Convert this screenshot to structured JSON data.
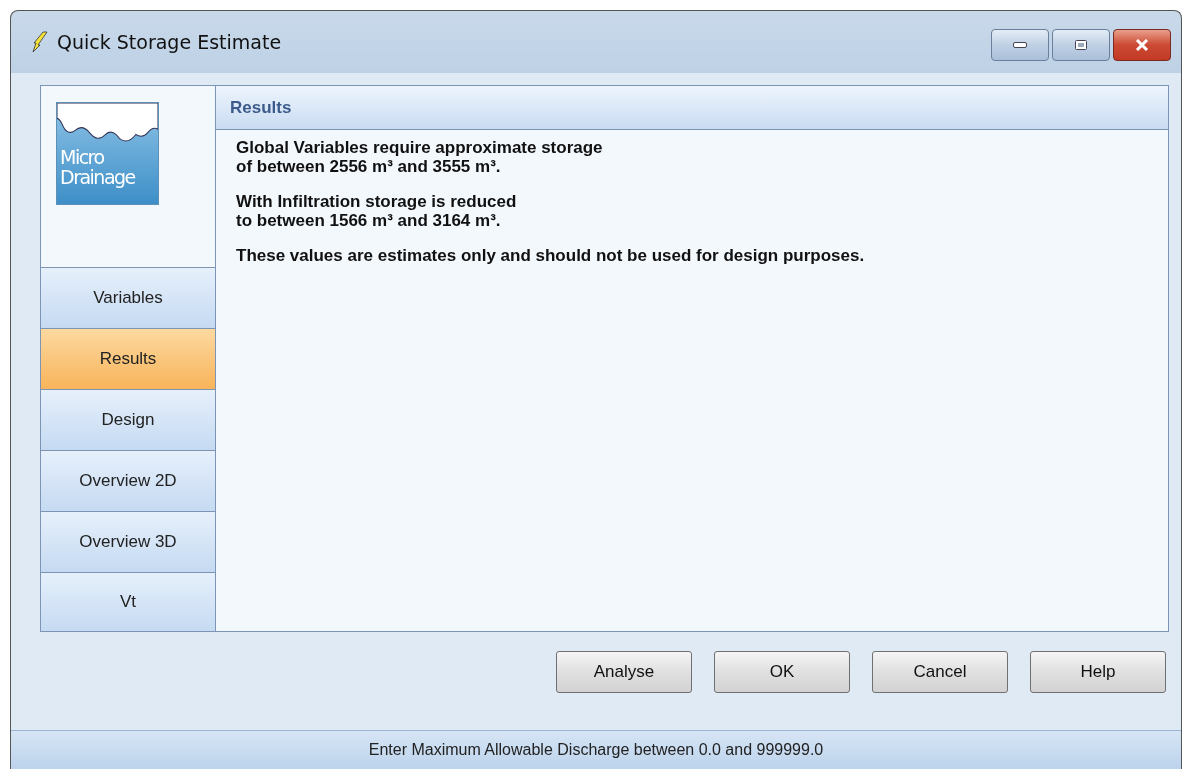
{
  "window": {
    "title": "Quick Storage Estimate"
  },
  "logo": {
    "lines": [
      "Micro",
      "Drainage"
    ]
  },
  "nav": [
    {
      "label": "Variables",
      "selected": false
    },
    {
      "label": "Results",
      "selected": true
    },
    {
      "label": "Design",
      "selected": false
    },
    {
      "label": "Overview 2D",
      "selected": false
    },
    {
      "label": "Overview 3D",
      "selected": false
    },
    {
      "label": "Vt",
      "selected": false
    }
  ],
  "panel": {
    "title": "Results",
    "paragraphs": [
      [
        "Global Variables require approximate storage",
        "of between 2556 m³ and 3555 m³."
      ],
      [
        "With Infiltration storage is reduced",
        "to between 1566 m³ and 3164 m³."
      ],
      [
        "These values are estimates only and should not be used for design purposes."
      ]
    ]
  },
  "buttons": [
    "Analyse",
    "OK",
    "Cancel",
    "Help"
  ],
  "status_bar": "Enter Maximum Allowable Discharge between 0.0 and 999999.0"
}
